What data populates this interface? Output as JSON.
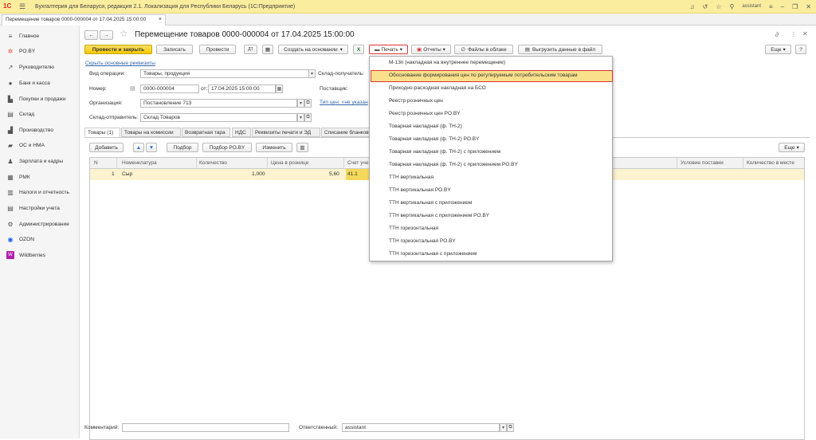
{
  "app": {
    "title": "Бухгалтерия для Беларуси, редакция 2.1. Локализация для Республики Беларусь (1С:Предприятие)",
    "logo": "1С",
    "user": "assistant"
  },
  "tab": {
    "label": "Перемещение товаров 0000-000004 от 17.04.2025 15:00:00"
  },
  "sidebar": {
    "items": [
      {
        "label": "Главное",
        "icon": "menu-icon"
      },
      {
        "label": "PO.BY",
        "icon": "asterisk-icon"
      },
      {
        "label": "Руководителю",
        "icon": "chart-icon"
      },
      {
        "label": "Банк и касса",
        "icon": "bank-icon"
      },
      {
        "label": "Покупки и продажи",
        "icon": "cart-icon"
      },
      {
        "label": "Склад",
        "icon": "warehouse-icon"
      },
      {
        "label": "Производство",
        "icon": "factory-icon"
      },
      {
        "label": "ОС и НМА",
        "icon": "truck-icon"
      },
      {
        "label": "Зарплата и кадры",
        "icon": "people-icon"
      },
      {
        "label": "РМК",
        "icon": "register-icon"
      },
      {
        "label": "Налоги и отчетность",
        "icon": "tax-icon"
      },
      {
        "label": "Настройки учета",
        "icon": "settings-doc-icon"
      },
      {
        "label": "Администрирование",
        "icon": "gear-icon"
      },
      {
        "label": "OZON",
        "icon": "ozon-icon"
      },
      {
        "label": "Wildberries",
        "icon": "wb-icon"
      }
    ]
  },
  "doc": {
    "title": "Перемещение товаров 0000-000004 от 17.04.2025 15:00:00"
  },
  "toolbar": {
    "post_close": "Провести и закрыть",
    "save": "Записать",
    "post": "Провести",
    "create_based": "Создать на основании",
    "print": "Печать",
    "reports": "Отчеты",
    "files": "Файлы в облаке",
    "export": "Выгрузить данные в файл",
    "more": "Еще"
  },
  "form": {
    "hide_link": "Скрыть основные реквизиты",
    "op_label": "Вид операции:",
    "op_value": "Товары, продукция",
    "num_label": "Номер:",
    "num_value": "0000-000004",
    "date_label": "от:",
    "date_value": "17.04.2025 15:00:00",
    "org_label": "Организация:",
    "org_value": "Постановление 713",
    "src_label": "Склад-отправитель:",
    "src_value": "Склад Товаров",
    "dst_label": "Склад-получатель:",
    "supplier_label": "Поставщик:",
    "price_link": "Тип цен: <не указан"
  },
  "tabs": [
    "Товары (1)",
    "Товары на комиссии",
    "Возвратная тара",
    "НДС",
    "Реквизиты печати и ЭД",
    "Списание бланков"
  ],
  "table": {
    "add": "Добавить",
    "select": "Подбор",
    "select_poby": "Подбор PO.BY",
    "change": "Изменить",
    "more": "Еще",
    "headers": [
      "N",
      "Номенклатура",
      "Количество",
      "Цена в рознице",
      "Счет уче",
      "Условие поставки",
      "Количество в месте"
    ],
    "rows": [
      {
        "n": "1",
        "name": "Сыр",
        "qty": "1,000",
        "price": "5,60",
        "account": "41.1"
      }
    ]
  },
  "print_menu": [
    "М-13п (накладная на внутреннее перемещение)",
    "Обоснование формирования цен по регулируемым потребительским товарам",
    "Приходно-расходная накладная на БСО",
    "Реестр розничных цен",
    "Реестр розничных цен PO.BY",
    "Товарная накладная (ф. ТН-2)",
    "Товарная накладная (ф. ТН-2) PO.BY",
    "Товарная накладная (ф. ТН-2) с приложением",
    "Товарная накладная (ф. ТН-2) с приложением PO.BY",
    "ТТН вертикальная",
    "ТТН вертикальная PO.BY",
    "ТТН вертикальная с приложением",
    "ТТН вертикальная с приложением PO.BY",
    "ТТН горизонтальная",
    "ТТН горизонтальная PO.BY",
    "ТТН горизонтальная с приложением"
  ],
  "footer": {
    "comment_label": "Комментарий:",
    "comment_value": "",
    "resp_label": "Ответственный:",
    "resp_value": "assistant"
  }
}
